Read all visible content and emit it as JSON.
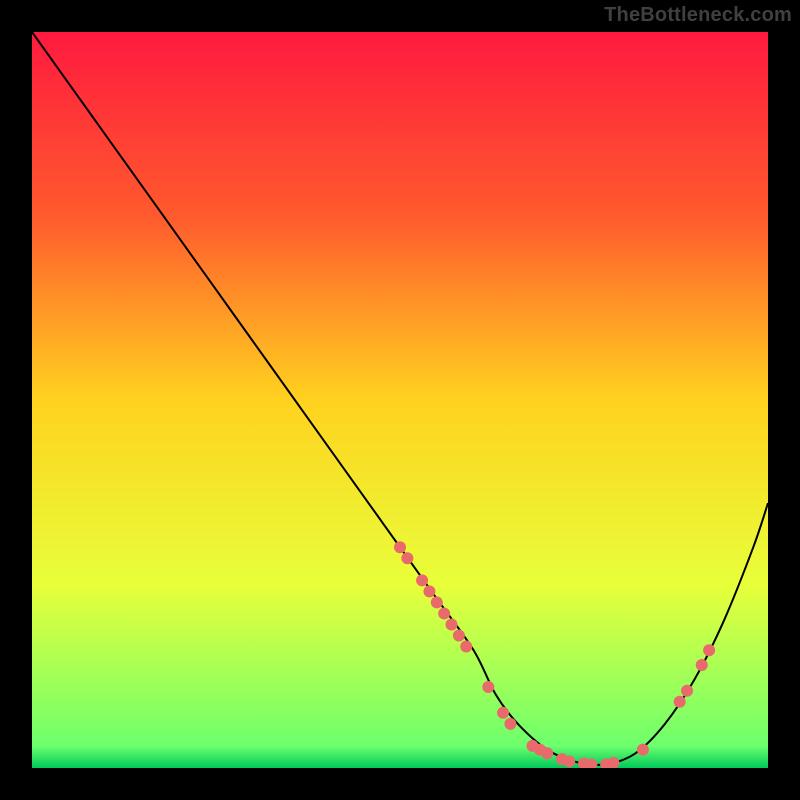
{
  "watermark": "TheBottleneck.com",
  "chart_data": {
    "type": "line",
    "title": "",
    "xlabel": "",
    "ylabel": "",
    "xlim": [
      0,
      100
    ],
    "ylim": [
      0,
      100
    ],
    "gradient_stops": [
      {
        "offset": 0,
        "color": "#ff1a3f"
      },
      {
        "offset": 25,
        "color": "#ff5a2d"
      },
      {
        "offset": 50,
        "color": "#ffd21f"
      },
      {
        "offset": 75,
        "color": "#e8ff3a"
      },
      {
        "offset": 97,
        "color": "#6dff6d"
      },
      {
        "offset": 100,
        "color": "#00c95b"
      }
    ],
    "series": [
      {
        "name": "curve",
        "x": [
          0,
          5,
          10,
          15,
          20,
          25,
          30,
          35,
          40,
          45,
          50,
          55,
          60,
          63,
          66,
          70,
          74,
          78,
          82,
          86,
          90,
          94,
          98,
          100
        ],
        "y": [
          100,
          93,
          86,
          79,
          72,
          65,
          58,
          51,
          44,
          37,
          30,
          23,
          16,
          10,
          6,
          2.5,
          0.8,
          0.5,
          2,
          6,
          12,
          20,
          30,
          36
        ]
      }
    ],
    "scatter": {
      "name": "markers",
      "color": "#e86a6a",
      "points": [
        {
          "x": 50,
          "y": 30
        },
        {
          "x": 51,
          "y": 28.5
        },
        {
          "x": 53,
          "y": 25.5
        },
        {
          "x": 54,
          "y": 24
        },
        {
          "x": 55,
          "y": 22.5
        },
        {
          "x": 56,
          "y": 21
        },
        {
          "x": 57,
          "y": 19.5
        },
        {
          "x": 58,
          "y": 18
        },
        {
          "x": 59,
          "y": 16.5
        },
        {
          "x": 62,
          "y": 11
        },
        {
          "x": 64,
          "y": 7.5
        },
        {
          "x": 65,
          "y": 6
        },
        {
          "x": 68,
          "y": 3
        },
        {
          "x": 69,
          "y": 2.5
        },
        {
          "x": 70,
          "y": 2
        },
        {
          "x": 72,
          "y": 1.2
        },
        {
          "x": 73,
          "y": 0.9
        },
        {
          "x": 75,
          "y": 0.6
        },
        {
          "x": 76,
          "y": 0.5
        },
        {
          "x": 78,
          "y": 0.5
        },
        {
          "x": 79,
          "y": 0.7
        },
        {
          "x": 83,
          "y": 2.5
        },
        {
          "x": 88,
          "y": 9
        },
        {
          "x": 89,
          "y": 10.5
        },
        {
          "x": 91,
          "y": 14
        },
        {
          "x": 92,
          "y": 16
        }
      ]
    }
  }
}
